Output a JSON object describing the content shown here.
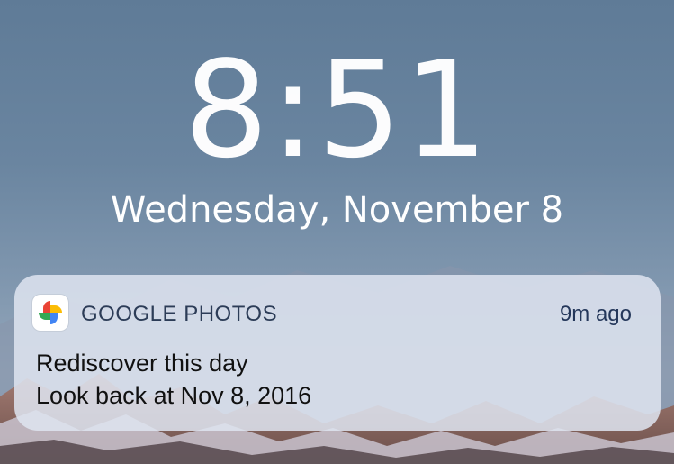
{
  "lock_screen": {
    "time": "8:51",
    "date": "Wednesday, November 8"
  },
  "notification": {
    "app_icon": "google-photos-pinwheel-icon",
    "app_name": "GOOGLE PHOTOS",
    "timestamp": "9m ago",
    "title": "Rediscover this day",
    "body": "Look back at Nov 8, 2016"
  },
  "colors": {
    "sky_top": "#5f7b97",
    "sky_bottom": "#93a6ba",
    "notification_bg": "#dee4f0",
    "app_name": "#2c3c57",
    "text": "#111111",
    "icon_blue": "#4285f4",
    "icon_red": "#ea4335",
    "icon_yellow": "#fbbc05",
    "icon_green": "#34a853"
  }
}
